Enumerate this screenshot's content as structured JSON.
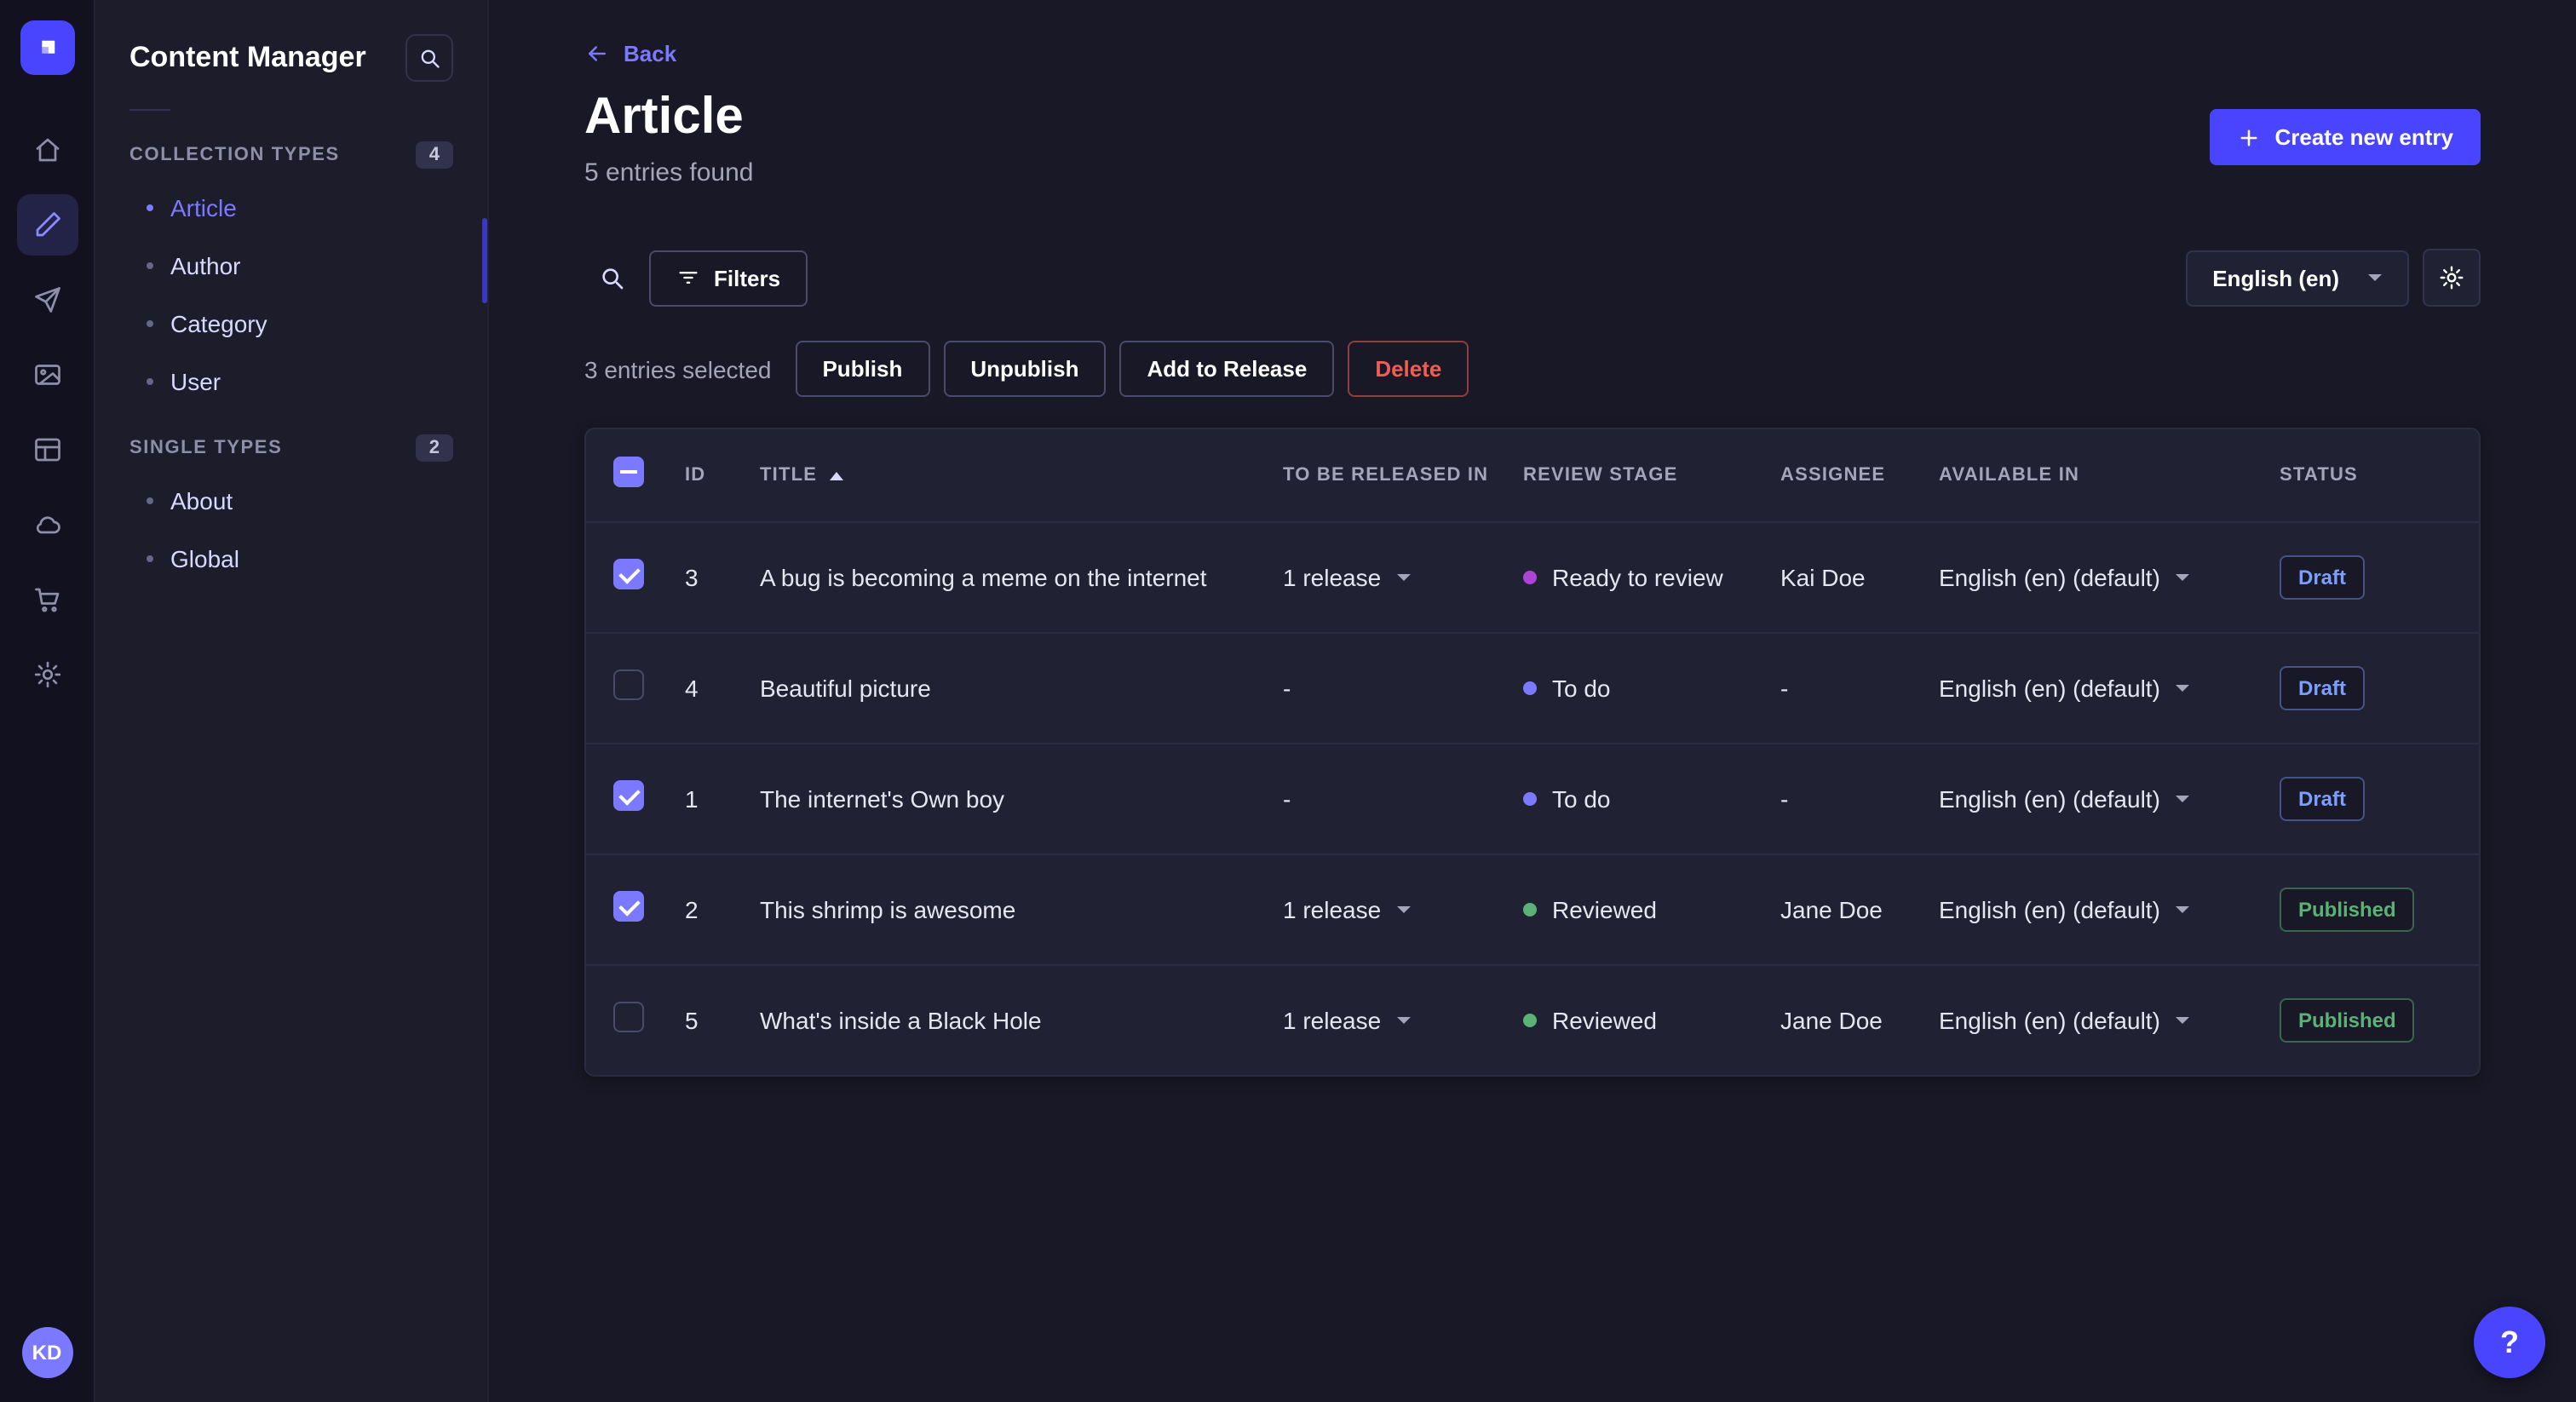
{
  "rail": {
    "avatar_initials": "KD",
    "icons": [
      "strapi-logo",
      "home",
      "content-manager",
      "releases",
      "media-library",
      "content-type-builder",
      "cloud",
      "marketplace",
      "settings"
    ]
  },
  "sidebar": {
    "title": "Content Manager",
    "sections": [
      {
        "label": "COLLECTION TYPES",
        "badge": "4",
        "items": [
          {
            "label": "Article",
            "active": true
          },
          {
            "label": "Author",
            "active": false
          },
          {
            "label": "Category",
            "active": false
          },
          {
            "label": "User",
            "active": false
          }
        ]
      },
      {
        "label": "SINGLE TYPES",
        "badge": "2",
        "items": [
          {
            "label": "About",
            "active": false
          },
          {
            "label": "Global",
            "active": false
          }
        ]
      }
    ]
  },
  "header": {
    "back_label": "Back",
    "title": "Article",
    "subtitle": "5 entries found",
    "create_label": "Create new entry"
  },
  "toolbar": {
    "filters_label": "Filters",
    "locale": "English (en)"
  },
  "selection": {
    "count_label": "3 entries selected",
    "publish_label": "Publish",
    "unpublish_label": "Unpublish",
    "add_to_release_label": "Add to Release",
    "delete_label": "Delete"
  },
  "table": {
    "columns": [
      "ID",
      "TITLE",
      "TO BE RELEASED IN",
      "REVIEW STAGE",
      "ASSIGNEE",
      "AVAILABLE IN",
      "STATUS"
    ],
    "rows": [
      {
        "checked": true,
        "id": "3",
        "title": "A bug is becoming a meme on the internet",
        "release": "1 release",
        "release_caret": true,
        "review_stage": "Ready to review",
        "review_color": "#ac45d6",
        "assignee": "Kai Doe",
        "available_in": "English (en) (default)",
        "status": "Draft"
      },
      {
        "checked": false,
        "id": "4",
        "title": "Beautiful picture",
        "release": "-",
        "release_caret": false,
        "review_stage": "To do",
        "review_color": "#7b79ff",
        "assignee": "-",
        "available_in": "English (en) (default)",
        "status": "Draft"
      },
      {
        "checked": true,
        "id": "1",
        "title": "The internet's Own boy",
        "release": "-",
        "release_caret": false,
        "review_stage": "To do",
        "review_color": "#7b79ff",
        "assignee": "-",
        "available_in": "English (en) (default)",
        "status": "Draft"
      },
      {
        "checked": true,
        "id": "2",
        "title": "This shrimp is awesome",
        "release": "1 release",
        "release_caret": true,
        "review_stage": "Reviewed",
        "review_color": "#5cb176",
        "assignee": "Jane Doe",
        "available_in": "English (en) (default)",
        "status": "Published"
      },
      {
        "checked": false,
        "id": "5",
        "title": "What's inside a Black Hole",
        "release": "1 release",
        "release_caret": true,
        "review_stage": "Reviewed",
        "review_color": "#5cb176",
        "assignee": "Jane Doe",
        "available_in": "English (en) (default)",
        "status": "Published"
      }
    ]
  },
  "colors": {
    "accent": "#4945ff",
    "link": "#7b79ff",
    "danger": "#ee5e52",
    "success": "#5cb176"
  },
  "help": {
    "label": "?"
  }
}
